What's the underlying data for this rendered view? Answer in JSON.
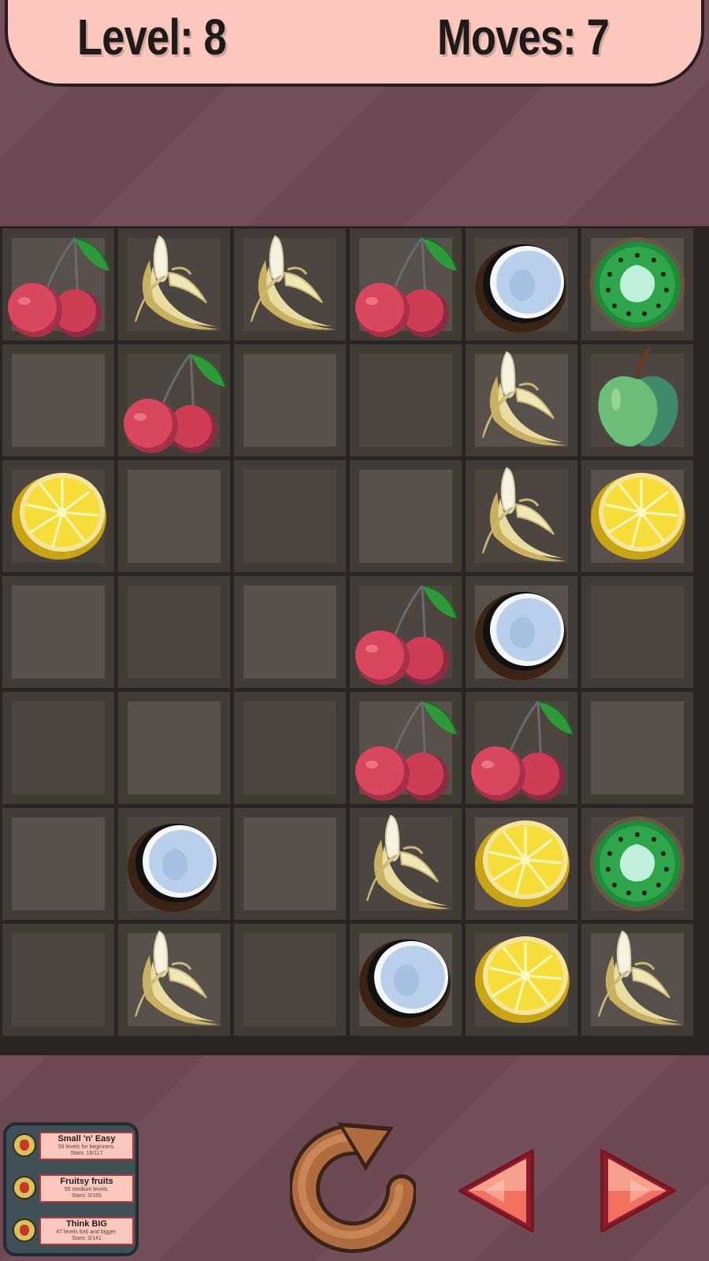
{
  "hud": {
    "level_label": "Level:",
    "level_value": "8",
    "moves_label": "Moves:",
    "moves_value": "7"
  },
  "board": {
    "rows": 7,
    "cols": 6,
    "cells": [
      [
        "cherry",
        "banana",
        "banana",
        "cherry",
        "coconut",
        "kiwi"
      ],
      [
        "",
        "cherry",
        "",
        "",
        "banana",
        "apple"
      ],
      [
        "lemon",
        "",
        "",
        "",
        "banana",
        "lemon"
      ],
      [
        "",
        "",
        "",
        "cherry",
        "coconut",
        ""
      ],
      [
        "",
        "",
        "",
        "cherry",
        "cherry",
        ""
      ],
      [
        "",
        "coconut",
        "",
        "banana",
        "lemon",
        "kiwi"
      ],
      [
        "",
        "banana",
        "",
        "coconut",
        "lemon",
        "banana"
      ]
    ],
    "light_tiles": [
      [
        1,
        0,
        0,
        1,
        0,
        1
      ],
      [
        1,
        0,
        1,
        0,
        1,
        0
      ],
      [
        0,
        1,
        0,
        1,
        0,
        1
      ],
      [
        1,
        0,
        1,
        0,
        1,
        0
      ],
      [
        0,
        1,
        0,
        1,
        0,
        1
      ],
      [
        1,
        0,
        1,
        0,
        1,
        0
      ],
      [
        0,
        1,
        0,
        1,
        0,
        1
      ]
    ]
  },
  "packs": [
    {
      "name": "Small 'n' Easy",
      "desc": "39 levels for beginners.",
      "stars": "Stars: 18/117"
    },
    {
      "name": "Fruitsy fruits",
      "desc": "55 medium levels.",
      "stars": "Stars: 0/165"
    },
    {
      "name": "Think BIG",
      "desc": "47 levels 6x6 and bigger.",
      "stars": "Stars: 0/141"
    }
  ],
  "controls": {
    "restart_icon": "restart-icon",
    "prev_icon": "previous-arrow-icon",
    "next_icon": "next-arrow-icon"
  },
  "colors": {
    "background": "#6e4852",
    "header": "#fcc8bd",
    "board": "#2a2522",
    "arrow": "#f26d5b",
    "restart": "#a8643a"
  }
}
